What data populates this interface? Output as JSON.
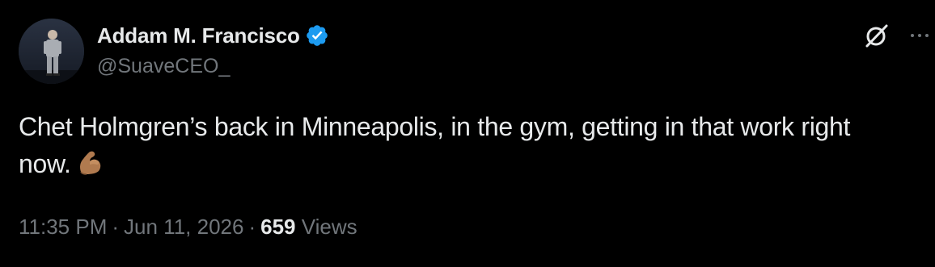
{
  "author": {
    "display_name": "Addam M. Francisco",
    "handle": "@SuaveCEO_",
    "verified": true,
    "verified_color": "#1d9bf0"
  },
  "tweet": {
    "text": "Chet Holmgren’s back in Minneapolis, in the gym, getting in that work right now.",
    "emoji": "flexed-biceps-medium-skin-tone"
  },
  "meta": {
    "time": "11:35 PM",
    "separator": "·",
    "date": "Jun 11, 2026",
    "views_count": "659",
    "views_label": "Views"
  },
  "icons": {
    "grok": "grok-icon",
    "more": "more-icon",
    "verified": "verified-badge-icon"
  },
  "colors": {
    "background": "#000000",
    "primary_text": "#e7e9ea",
    "secondary_text": "#71767b",
    "accent": "#1d9bf0"
  }
}
